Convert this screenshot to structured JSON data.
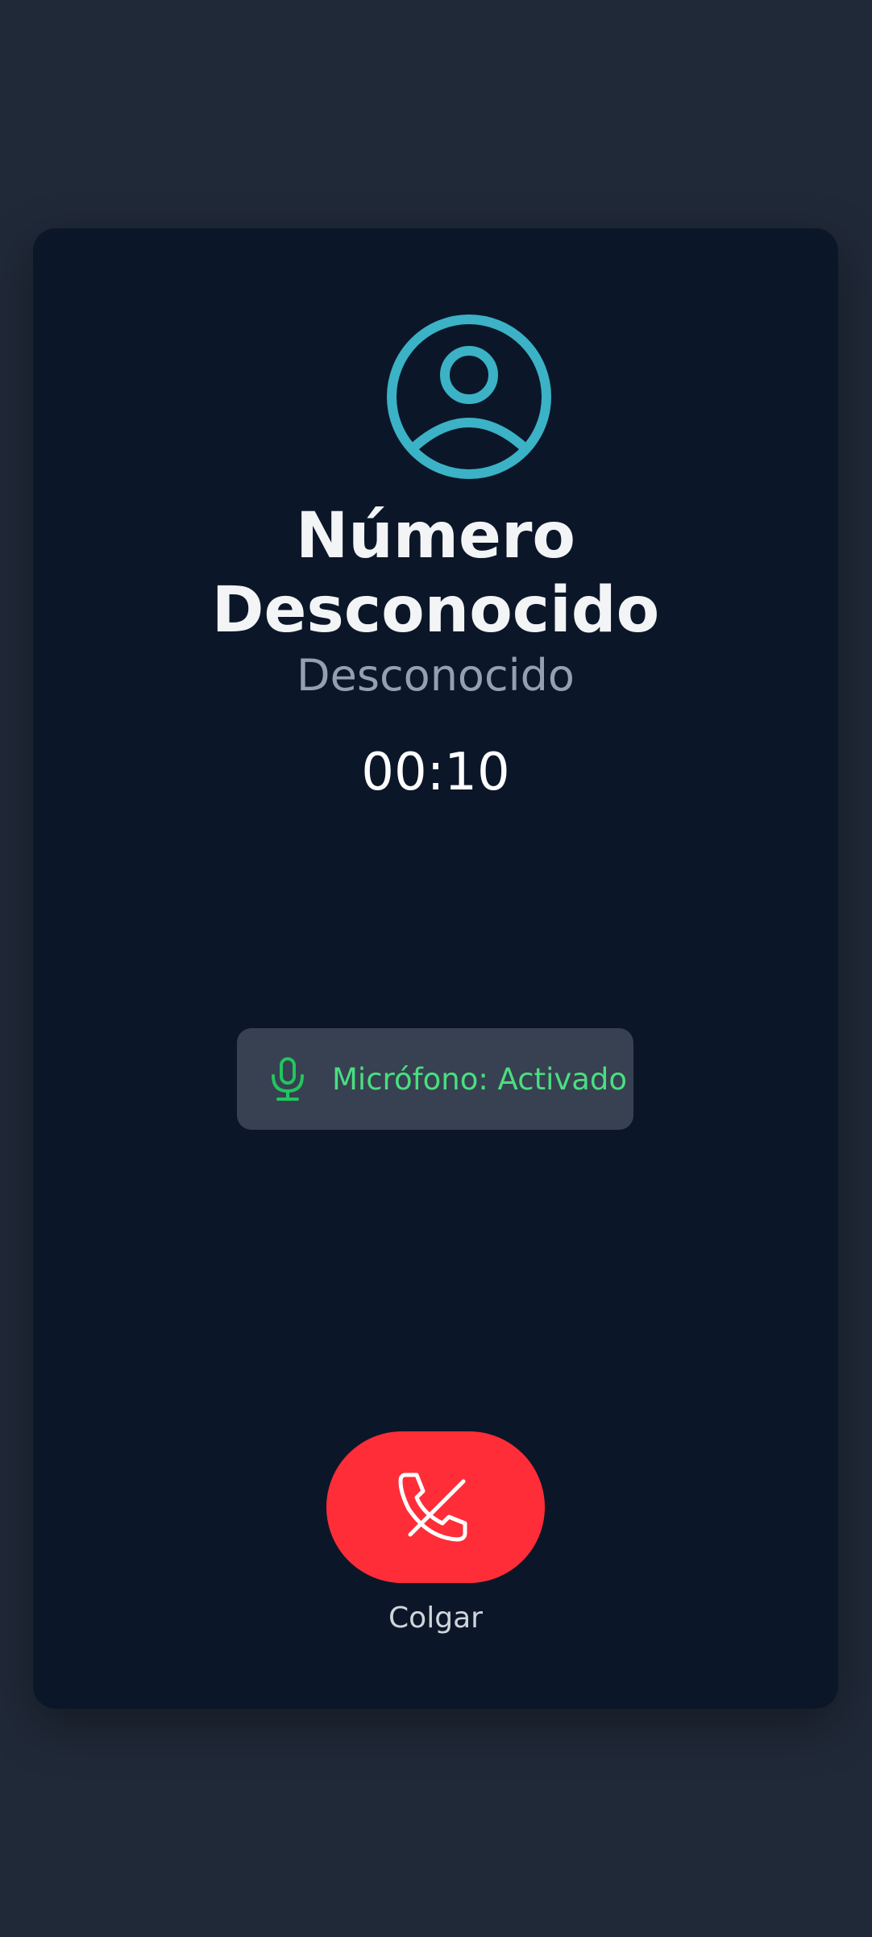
{
  "call": {
    "name_line1": "Número",
    "name_line2": "Desconocido",
    "subtitle": "Desconocido",
    "duration": "00:10"
  },
  "microphone": {
    "status_label": "Micrófono: Activado",
    "icon": "microphone-icon",
    "color": "#4ade80"
  },
  "hangup": {
    "label": "Colgar",
    "icon": "phone-off-icon",
    "color": "#ff2d37"
  },
  "avatar": {
    "icon": "user-circle-icon",
    "color": "#3bb2c6"
  }
}
